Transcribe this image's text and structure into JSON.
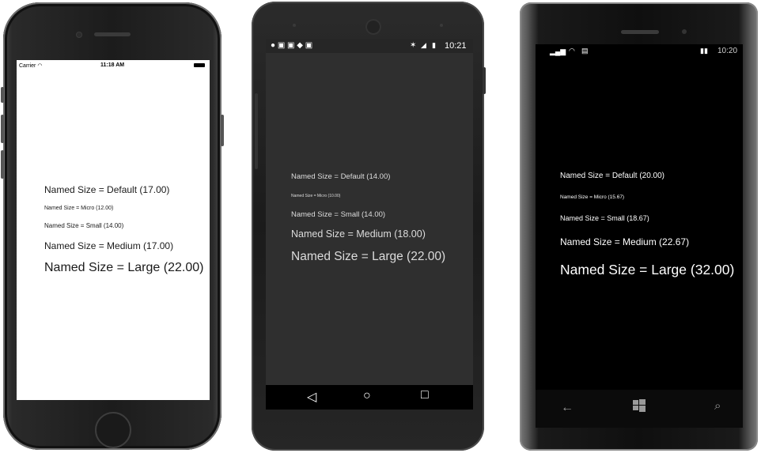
{
  "ios": {
    "status": {
      "carrier": "Carrier",
      "time": "11:18 AM"
    },
    "labels": [
      "Named Size = Default (17.00)",
      "Named Size = Micro (12.00)",
      "Named Size = Small (14.00)",
      "Named Size = Medium (17.00)",
      "Named Size = Large (22.00)"
    ]
  },
  "android": {
    "status": {
      "time": "10:21"
    },
    "labels": [
      "Named Size = Default (14.00)",
      "Named Size = Micro (10.00)",
      "Named Size = Small (14.00)",
      "Named Size = Medium (18.00)",
      "Named Size = Large (22.00)"
    ],
    "nav": {
      "back": "◁",
      "home": "○",
      "recents": "□"
    }
  },
  "windows": {
    "status": {
      "time": "10:20"
    },
    "labels": [
      "Named Size = Default (20.00)",
      "Named Size = Micro (15.67)",
      "Named Size = Small (18.67)",
      "Named Size = Medium (22.67)",
      "Named Size = Large (32.00)"
    ],
    "nav": {
      "back": "←",
      "search": "⌕"
    }
  },
  "colors": {
    "ios_screen": "#ffffff",
    "android_screen": "#2f2f2f",
    "windows_screen": "#000000"
  }
}
